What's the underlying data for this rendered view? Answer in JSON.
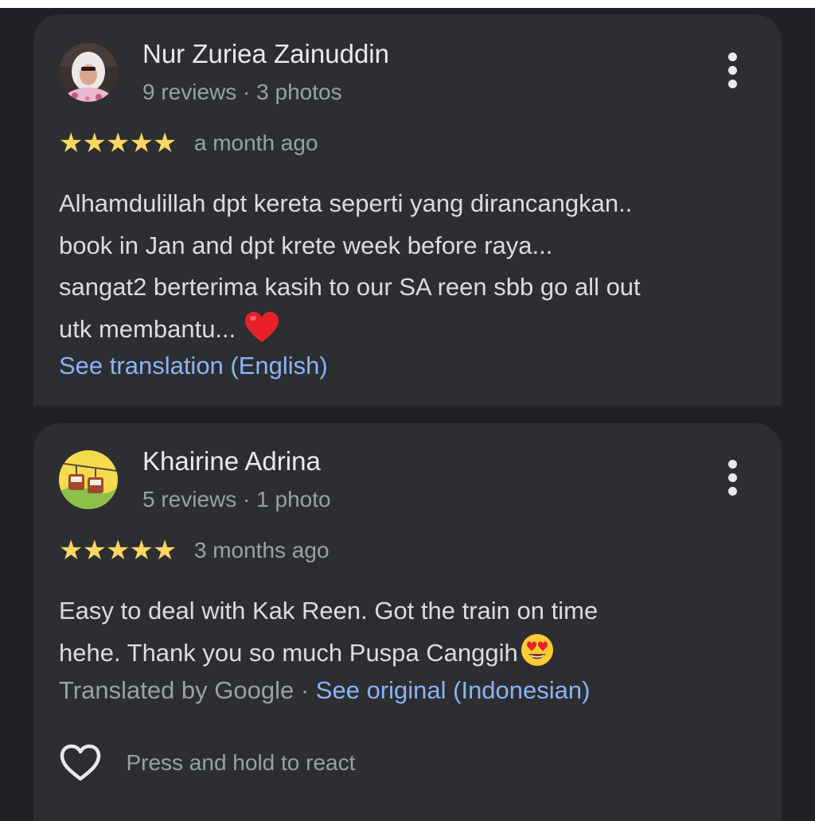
{
  "colors": {
    "background": "#202124",
    "card": "#2d2e31",
    "star": "#fdd663",
    "link": "#8ab4f8",
    "secondary_text": "#9aa0a6"
  },
  "reviews": [
    {
      "author": "Nur Zuriea Zainuddin",
      "stats": "9 reviews · 3 photos",
      "rating": 5,
      "stars": "★★★★★",
      "date": "a month ago",
      "text_lines": [
        "Alhamdulillah dpt kereta seperti yang dirancangkan..",
        "book in Jan and dpt krete week before raya...",
        "sangat2 berterima kasih to our SA reen sbb go all out",
        "utk membantu..."
      ],
      "emoji": "red-heart",
      "translate_link": "See translation (English)",
      "menu_icon": "more-vert-icon"
    },
    {
      "author": "Khairine Adrina",
      "stats": "5 reviews · 1 photo",
      "rating": 5,
      "stars": "★★★★★",
      "date": "3 months ago",
      "text_lines": [
        "Easy to deal with Kak Reen. Got the train on time",
        "hehe. Thank you so much Puspa Canggih"
      ],
      "emoji": "heart-eyes",
      "translated_by": "Translated by Google · ",
      "see_original": "See original (Indonesian)",
      "react_label": "Press and hold to react",
      "react_icon": "heart-outline-icon",
      "menu_icon": "more-vert-icon"
    }
  ]
}
